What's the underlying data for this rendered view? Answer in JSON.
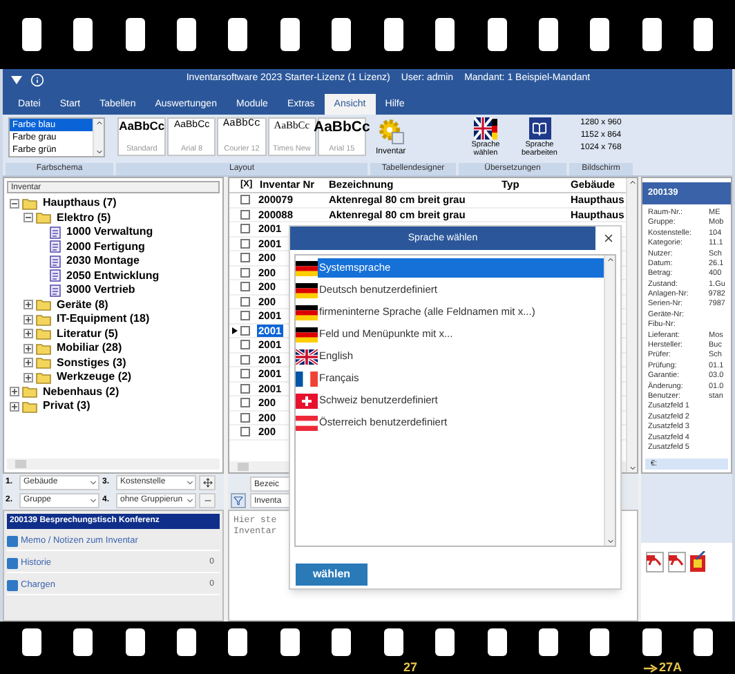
{
  "window": {
    "title": "Inventarsoftware 2023 Starter-Lizenz (1 Lizenz)",
    "user": "User: admin",
    "mandant": "Mandant: 1 Beispiel-Mandant"
  },
  "menu": [
    {
      "label": "Datei",
      "selected": false
    },
    {
      "label": "Start",
      "selected": false
    },
    {
      "label": "Tabellen",
      "selected": false
    },
    {
      "label": "Auswertungen",
      "selected": false
    },
    {
      "label": "Module",
      "selected": false
    },
    {
      "label": "Extras",
      "selected": false
    },
    {
      "label": "Ansicht",
      "selected": true
    },
    {
      "label": "Hilfe",
      "selected": false
    }
  ],
  "ribbon": {
    "farbschema": {
      "label": "Farbschema",
      "items": [
        {
          "label": "Farbe blau",
          "selected": true
        },
        {
          "label": "Farbe grau",
          "selected": false
        },
        {
          "label": "Farbe grün",
          "selected": false
        }
      ]
    },
    "layout": {
      "label": "Layout",
      "styles": [
        {
          "sample": "AaBbCc",
          "caption": "Standard",
          "kind": "standard"
        },
        {
          "sample": "AaBbCc",
          "caption": "Arial 8",
          "kind": "small"
        },
        {
          "sample": "AaBbCc",
          "caption": "Courier 12",
          "kind": "courier"
        },
        {
          "sample": "AaBbCc",
          "caption": "Times New",
          "kind": "times"
        },
        {
          "sample": "AaBbCc",
          "caption": "Arial 15",
          "kind": "large"
        }
      ]
    },
    "tabellendesigner": {
      "label": "Tabellendesigner",
      "button": "Inventar"
    },
    "uebersetzungen": {
      "label": "Übersetzungen",
      "buttons": [
        {
          "label": "Sprache wählen",
          "kind": "flags"
        },
        {
          "label": "Sprache bearbeiten",
          "kind": "book"
        }
      ]
    },
    "bildschirm": {
      "label": "Bildschirm",
      "resolutions": [
        "1280 x 960",
        "1152 x 864",
        "1024 x 768"
      ]
    }
  },
  "tree": {
    "header": "Inventar",
    "nodes": [
      {
        "label": "Haupthaus (7)",
        "kind": "folder",
        "expanded": true,
        "children": [
          {
            "label": "Elektro (5)",
            "kind": "folder",
            "expanded": true,
            "children": [
              {
                "label": "1000 Verwaltung",
                "kind": "document"
              },
              {
                "label": "2000 Fertigung",
                "kind": "document"
              },
              {
                "label": "2030 Montage",
                "kind": "document"
              },
              {
                "label": "2050 Entwicklung",
                "kind": "document"
              },
              {
                "label": "3000 Vertrieb",
                "kind": "document"
              }
            ]
          },
          {
            "label": "Geräte (8)",
            "kind": "folder",
            "expanded": false
          },
          {
            "label": "IT-Equipment (18)",
            "kind": "folder",
            "expanded": false
          },
          {
            "label": "Literatur (5)",
            "kind": "folder",
            "expanded": false
          },
          {
            "label": "Mobiliar (28)",
            "kind": "folder",
            "expanded": false
          },
          {
            "label": "Sonstiges (3)",
            "kind": "folder",
            "expanded": false
          },
          {
            "label": "Werkzeuge (2)",
            "kind": "folder",
            "expanded": false
          }
        ]
      },
      {
        "label": "Nebenhaus (2)",
        "kind": "folder",
        "expanded": false
      },
      {
        "label": "Privat (3)",
        "kind": "folder",
        "expanded": false
      }
    ]
  },
  "table": {
    "columns": [
      "[X]",
      "Inventar Nr",
      "Bezeichnung",
      "Typ",
      "Gebäude"
    ],
    "rows": [
      {
        "checked": false,
        "selected": false,
        "inventar_nr": "200079",
        "bezeichnung": "Aktenregal 80 cm breit grau",
        "gebaeude": "Haupthaus"
      },
      {
        "checked": false,
        "selected": false,
        "inventar_nr": "200088",
        "bezeichnung": "Aktenregal 80 cm breit grau",
        "gebaeude": "Haupthaus"
      },
      {
        "checked": false,
        "selected": false,
        "inventar_nr": "2001"
      },
      {
        "checked": false,
        "selected": false,
        "inventar_nr": "2001"
      },
      {
        "checked": false,
        "selected": false,
        "inventar_nr": "200"
      },
      {
        "checked": false,
        "selected": false,
        "inventar_nr": "200"
      },
      {
        "checked": false,
        "selected": false,
        "inventar_nr": "200"
      },
      {
        "checked": false,
        "selected": false,
        "inventar_nr": "200"
      },
      {
        "checked": false,
        "selected": false,
        "inventar_nr": "2001"
      },
      {
        "checked": false,
        "selected": true,
        "inventar_nr": "2001"
      },
      {
        "checked": false,
        "selected": false,
        "inventar_nr": "2001"
      },
      {
        "checked": false,
        "selected": false,
        "inventar_nr": "2001"
      },
      {
        "checked": false,
        "selected": false,
        "inventar_nr": "2001"
      },
      {
        "checked": false,
        "selected": false,
        "inventar_nr": "2001"
      },
      {
        "checked": false,
        "selected": false,
        "inventar_nr": "200"
      },
      {
        "checked": false,
        "selected": false,
        "inventar_nr": "200"
      },
      {
        "checked": false,
        "selected": false,
        "inventar_nr": "200"
      }
    ]
  },
  "grouping": [
    {
      "number": "1.",
      "value": "Gebäude"
    },
    {
      "number": "3.",
      "value": "Kostenstelle"
    },
    {
      "number": "2.",
      "value": "Gruppe"
    },
    {
      "number": "4.",
      "value": "ohne Gruppierun"
    }
  ],
  "filter_fields": [
    "Bezeic",
    "Inventa"
  ],
  "memo_lines": [
    "Hier ste",
    "Inventar"
  ],
  "detail_panel": {
    "title": "200139 Besprechungstisch Konferenz",
    "items": [
      {
        "label": "Memo / Notizen zum Inventar"
      },
      {
        "label": "Historie",
        "count": "0"
      },
      {
        "label": "Chargen",
        "count": "0"
      }
    ]
  },
  "properties": {
    "title": "200139",
    "fields": [
      {
        "label": "Raum-Nr.:",
        "value": "ME"
      },
      {
        "label": "Gruppe:",
        "value": "Mob"
      },
      {
        "label": "Kostenstelle:",
        "value": "104"
      },
      {
        "label": "Kategorie:",
        "value": "11.1"
      },
      {
        "label": "Nutzer:",
        "value": "Sch"
      },
      {
        "label": "Datum:",
        "value": "26.1"
      },
      {
        "label": "Betrag:",
        "value": "400"
      },
      {
        "label": "Zustand:",
        "value": "1.Gu"
      },
      {
        "label": "Anlagen-Nr:",
        "value": "9782"
      },
      {
        "label": "Serien-Nr:",
        "value": "7987"
      },
      {
        "label": "Geräte-Nr:"
      },
      {
        "label": "Fibu-Nr:"
      },
      {
        "label": "Lieferant:",
        "value": "Mos"
      },
      {
        "label": "Hersteller:",
        "value": "Buc"
      },
      {
        "label": "Prüfer:",
        "value": "Sch"
      },
      {
        "label": "Prüfung:",
        "value": "01.1"
      },
      {
        "label": "Garantie:",
        "value": "03.0"
      },
      {
        "label": "Änderung:",
        "value": "01.0"
      },
      {
        "label": "Benutzer:",
        "value": "stan"
      },
      {
        "label": "Zusatzfeld 1"
      },
      {
        "label": "Zusatzfeld 2"
      },
      {
        "label": "Zusatzfeld 3"
      },
      {
        "label": "Zusatzfeld 4"
      },
      {
        "label": "Zusatzfeld 5"
      }
    ],
    "footer": "€:"
  },
  "dialog": {
    "title": "Sprache wählen",
    "options": [
      {
        "label": "Systemsprache",
        "kind": "de",
        "selected": true
      },
      {
        "label": "Deutsch benutzerdefiniert",
        "kind": "de",
        "selected": false
      },
      {
        "label": "firmeninterne Sprache (alle Feldnamen mit x...)",
        "kind": "de",
        "selected": false
      },
      {
        "label": "Feld und Menüpunkte mit x...",
        "kind": "de",
        "selected": false
      },
      {
        "label": "English",
        "kind": "gb",
        "selected": false
      },
      {
        "label": "Français",
        "kind": "fr",
        "selected": false
      },
      {
        "label": "Schweiz benutzerdefiniert",
        "kind": "ch",
        "selected": false
      },
      {
        "label": "Österreich benutzerdefiniert",
        "kind": "at",
        "selected": false
      }
    ],
    "button": "wählen"
  },
  "film": {
    "frame_numbers": [
      "27",
      "27A"
    ]
  }
}
